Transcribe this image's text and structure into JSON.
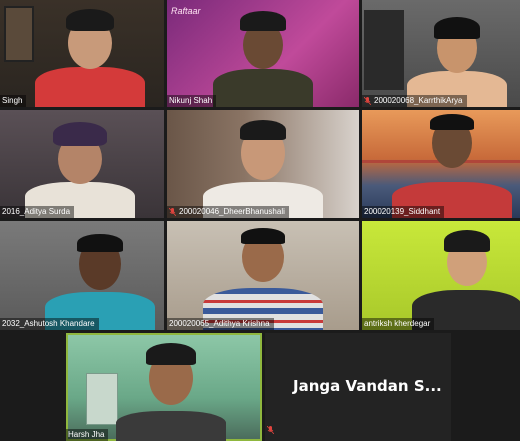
{
  "tiles": [
    {
      "id": "t1",
      "name": "Singh",
      "muted": false
    },
    {
      "id": "t2",
      "name": "Nikunj Shah",
      "muted": false,
      "banner": "Raftaar"
    },
    {
      "id": "t3",
      "name": "200020068_KarrthikArya",
      "muted": true
    },
    {
      "id": "t4",
      "name": "2016_Aditya Surda",
      "muted": false
    },
    {
      "id": "t5",
      "name": "200020046_DheerBhanushali",
      "muted": true
    },
    {
      "id": "t6",
      "name": "200020139_Siddhant",
      "muted": false
    },
    {
      "id": "t7",
      "name": "2032_Ashutosh Khandare",
      "muted": false
    },
    {
      "id": "t8",
      "name": "200020065_Adithya Krishna",
      "muted": false
    },
    {
      "id": "t9",
      "name": "antriksh kherdegar",
      "muted": false
    },
    {
      "id": "t10",
      "name": "Harsh Jha",
      "muted": false,
      "speaking": true
    },
    {
      "id": "t11",
      "name": "Janga Vandan S...",
      "muted": true,
      "video_off": true
    }
  ],
  "colors": {
    "speaker_outline": "#8fb73e",
    "muted_icon": "#e0443e",
    "background": "#1b1b1b"
  }
}
